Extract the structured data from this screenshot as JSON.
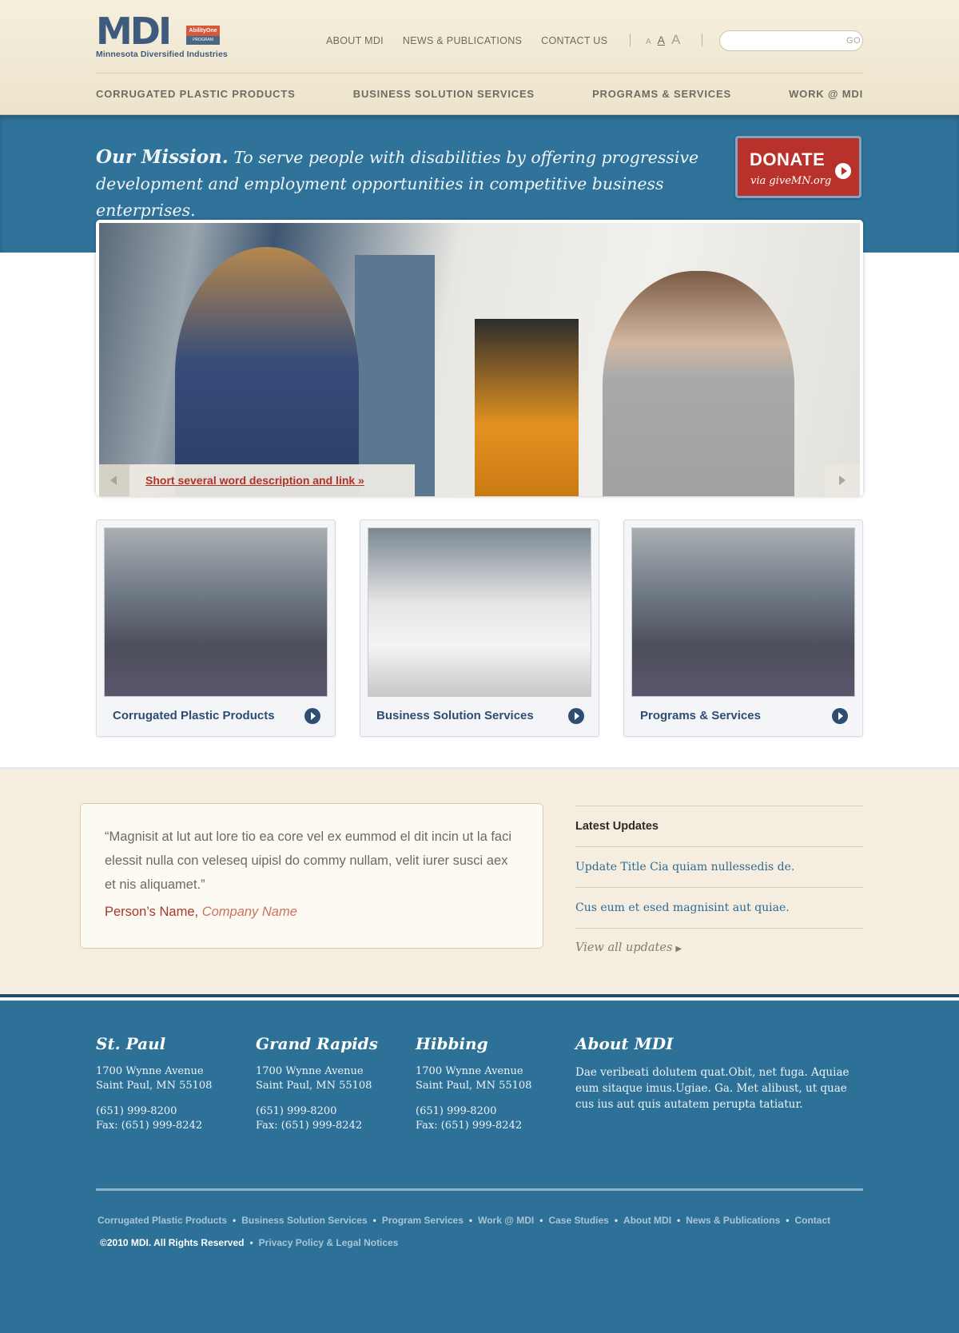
{
  "brand": {
    "logo": "MDI",
    "badge_top": "AbilityOne",
    "badge_bottom": "PROGRAM",
    "subtitle": "Minnesota Diversified Industries"
  },
  "topnav": [
    "ABOUT MDI",
    "NEWS & PUBLICATIONS",
    "CONTACT US"
  ],
  "text_size": [
    "A",
    "A",
    "A"
  ],
  "search": {
    "placeholder": "",
    "go_label": "GO"
  },
  "mainnav": [
    "CORRUGATED PLASTIC PRODUCTS",
    "BUSINESS SOLUTION SERVICES",
    "PROGRAMS & SERVICES",
    "WORK @ MDI"
  ],
  "mission": {
    "lead": "Our Mission.",
    "text": "To serve people with disabilities by offering progressive development and employment opportunities in competitive business enterprises."
  },
  "donate": {
    "label": "DONATE",
    "sub": "via giveMN.org"
  },
  "hero": {
    "caption": "Short several word description and link »"
  },
  "cards": [
    {
      "label": "Corrugated Plastic Products"
    },
    {
      "label": "Business Solution Services"
    },
    {
      "label": "Programs & Services"
    }
  ],
  "testimonial": {
    "quote": "Magnisit at lut aut lore tio ea core vel ex eummod el dit incin ut la faci elessit nulla con veleseq uipisl do commy nullam, velit iurer susci aex et nis aliquamet.",
    "name": "Person’s Name,",
    "company": "Company Name"
  },
  "updates": {
    "title": "Latest Updates",
    "items": [
      "Update Title Cia quiam nullessedis de.",
      "Cus eum et esed magnisint aut quiae."
    ],
    "view_all": "View all updates"
  },
  "offices": [
    {
      "city": "St. Paul",
      "street": "1700 Wynne Avenue",
      "citystate": "Saint Paul, MN 55108",
      "phone": "(651) 999-8200",
      "fax": "Fax: (651) 999-8242"
    },
    {
      "city": "Grand Rapids",
      "street": "1700 Wynne Avenue",
      "citystate": "Saint Paul, MN 55108",
      "phone": "(651) 999-8200",
      "fax": "Fax: (651) 999-8242"
    },
    {
      "city": "Hibbing",
      "street": "1700 Wynne Avenue",
      "citystate": "Saint Paul, MN 55108",
      "phone": "(651) 999-8200",
      "fax": "Fax: (651) 999-8242"
    }
  ],
  "about": {
    "title": "About MDI",
    "text": "Dae veribeati dolutem quat.Obit, net fuga. Aquiae eum sitaque imus.Ugiae. Ga. Met alibust, ut quae cus ius aut quis autatem perupta tatiatur."
  },
  "footer_links": [
    "Corrugated Plastic Products",
    "Business Solution Services",
    "Program Services",
    "Work @ MDI",
    "Case Studies",
    "About MDI",
    "News & Publications",
    "Contact"
  ],
  "copyright": "©2010 MDI. All Rights Reserved",
  "privacy": "Privacy Policy & Legal Notices",
  "colors": {
    "brand_blue": "#2e7198",
    "donate_red": "#b8312b",
    "cream": "#f5eee0",
    "link_blue": "#2f4d72"
  }
}
